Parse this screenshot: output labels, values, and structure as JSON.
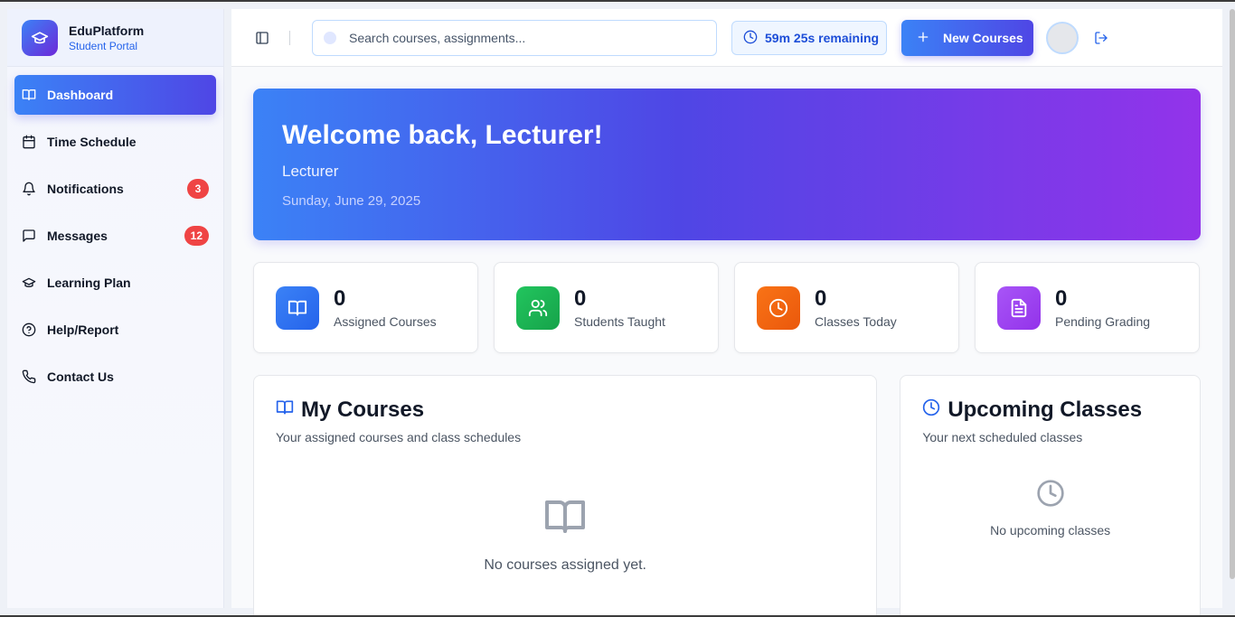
{
  "brand": {
    "name": "EduPlatform",
    "subtitle": "Student Portal"
  },
  "sidebar": {
    "items": [
      {
        "label": "Dashboard",
        "icon": "book-open-icon",
        "active": true
      },
      {
        "label": "Time Schedule",
        "icon": "calendar-icon"
      },
      {
        "label": "Notifications",
        "icon": "bell-icon",
        "badge": "3"
      },
      {
        "label": "Messages",
        "icon": "message-icon",
        "badge": "12"
      },
      {
        "label": "Learning Plan",
        "icon": "graduation-cap-icon"
      },
      {
        "label": "Help/Report",
        "icon": "help-circle-icon"
      },
      {
        "label": "Contact Us",
        "icon": "phone-icon"
      }
    ]
  },
  "topbar": {
    "search_placeholder": "Search courses, assignments...",
    "timer": "59m 25s remaining",
    "new_button": "New Courses"
  },
  "hero": {
    "title": "Welcome back, Lecturer!",
    "role": "Lecturer",
    "date": "Sunday, June 29, 2025"
  },
  "stats": [
    {
      "value": "0",
      "label": "Assigned Courses",
      "icon": "book-open-icon",
      "color": "#3b82f6"
    },
    {
      "value": "0",
      "label": "Students Taught",
      "icon": "users-icon",
      "color": "#22c55e"
    },
    {
      "value": "0",
      "label": "Classes Today",
      "icon": "clock-icon",
      "color": "#f97316"
    },
    {
      "value": "0",
      "label": "Pending Grading",
      "icon": "file-text-icon",
      "color": "#a855f7"
    }
  ],
  "courses": {
    "title": "My Courses",
    "subtitle": "Your assigned courses and class schedules",
    "empty": "No courses assigned yet."
  },
  "upcoming": {
    "title": "Upcoming Classes",
    "subtitle": "Your next scheduled classes",
    "empty": "No upcoming classes"
  },
  "colors": {
    "accent": "#4f46e5",
    "primary": "#3b82f6",
    "badge": "#ef4444"
  }
}
